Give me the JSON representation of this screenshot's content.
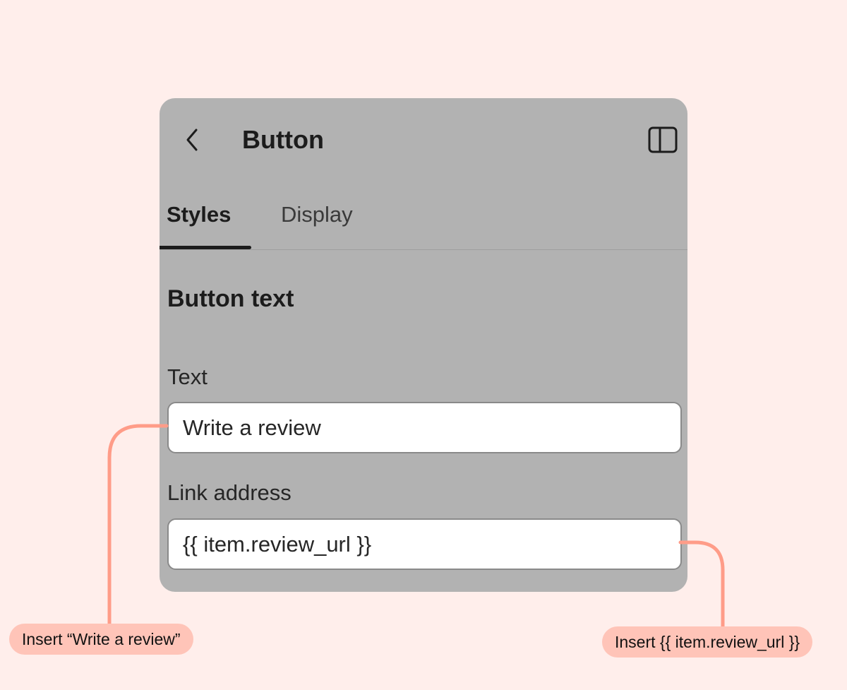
{
  "panel": {
    "title": "Button",
    "back_icon": "chevron-left-icon",
    "layout_icon": "sidebar-panel-icon",
    "tabs": [
      {
        "label": "Styles",
        "active": true
      },
      {
        "label": "Display",
        "active": false
      }
    ],
    "section_title": "Button text",
    "fields": {
      "text": {
        "label": "Text",
        "value": "Write a review"
      },
      "link": {
        "label": "Link address",
        "value": "{{ item.review_url }}"
      }
    }
  },
  "annotations": {
    "left": "Insert “Write a review”",
    "right": "Insert {{ item.review_url }}",
    "color": "#FF9C88",
    "bubble_color": "#FFC4B8"
  },
  "colors": {
    "background": "#FFEEEB",
    "panel": "#B2B2B2"
  }
}
